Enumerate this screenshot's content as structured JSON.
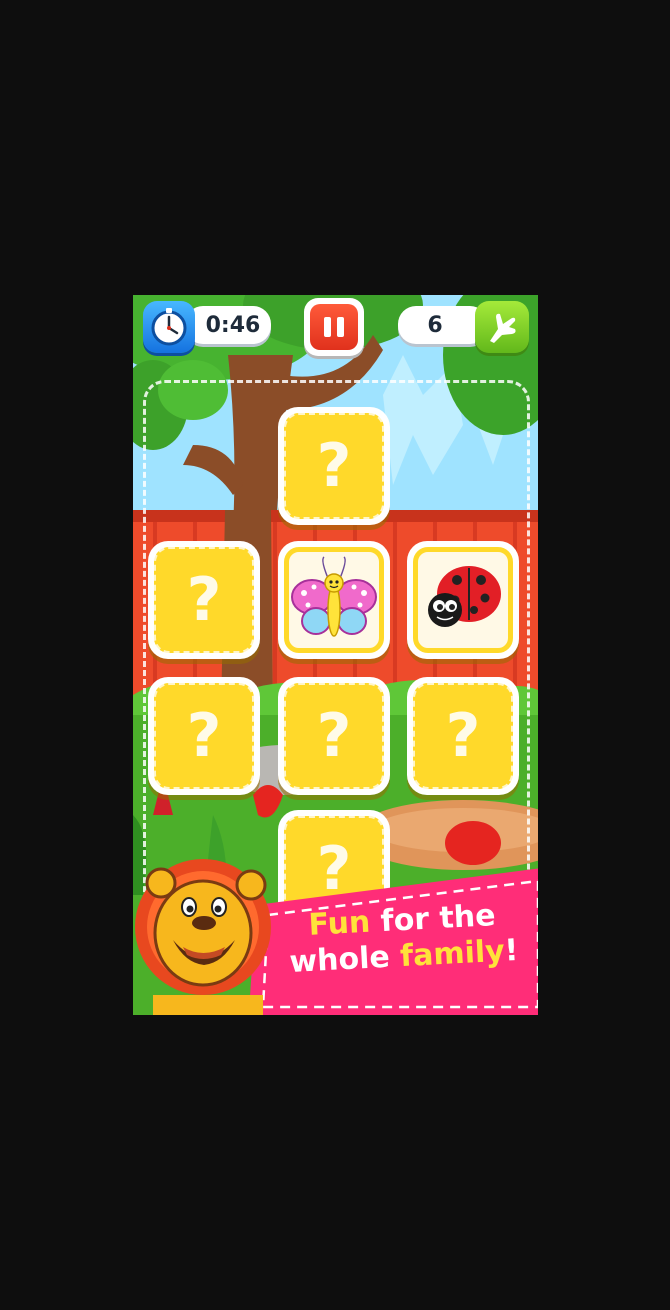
{
  "hud": {
    "timer": "0:46",
    "moves": "6",
    "timer_icon": "stopwatch-icon",
    "pause_icon": "pause-icon",
    "hint_icon": "pointing-hand-icon"
  },
  "cards": [
    {
      "id": "card-1",
      "state": "hidden",
      "symbol": "?"
    },
    {
      "id": "card-2",
      "state": "hidden",
      "symbol": "?"
    },
    {
      "id": "card-3",
      "state": "revealed",
      "image": "butterfly"
    },
    {
      "id": "card-4",
      "state": "revealed",
      "image": "ladybug"
    },
    {
      "id": "card-5",
      "state": "hidden",
      "symbol": "?"
    },
    {
      "id": "card-6",
      "state": "hidden",
      "symbol": "?"
    },
    {
      "id": "card-7",
      "state": "hidden",
      "symbol": "?"
    },
    {
      "id": "card-8",
      "state": "hidden",
      "symbol": "?"
    }
  ],
  "promo": {
    "word1": "Fun",
    "word2": " for the",
    "word3": "whole ",
    "word4": "family",
    "word5": "!",
    "mascot": "lion"
  },
  "colors": {
    "card_yellow": "#ffd92a",
    "banner_pink": "#ff2d78",
    "highlight_yellow": "#ffe23a",
    "fence_red": "#ee4b2b",
    "grass_green": "#4caf2a",
    "sky_blue": "#9fe3ff"
  }
}
